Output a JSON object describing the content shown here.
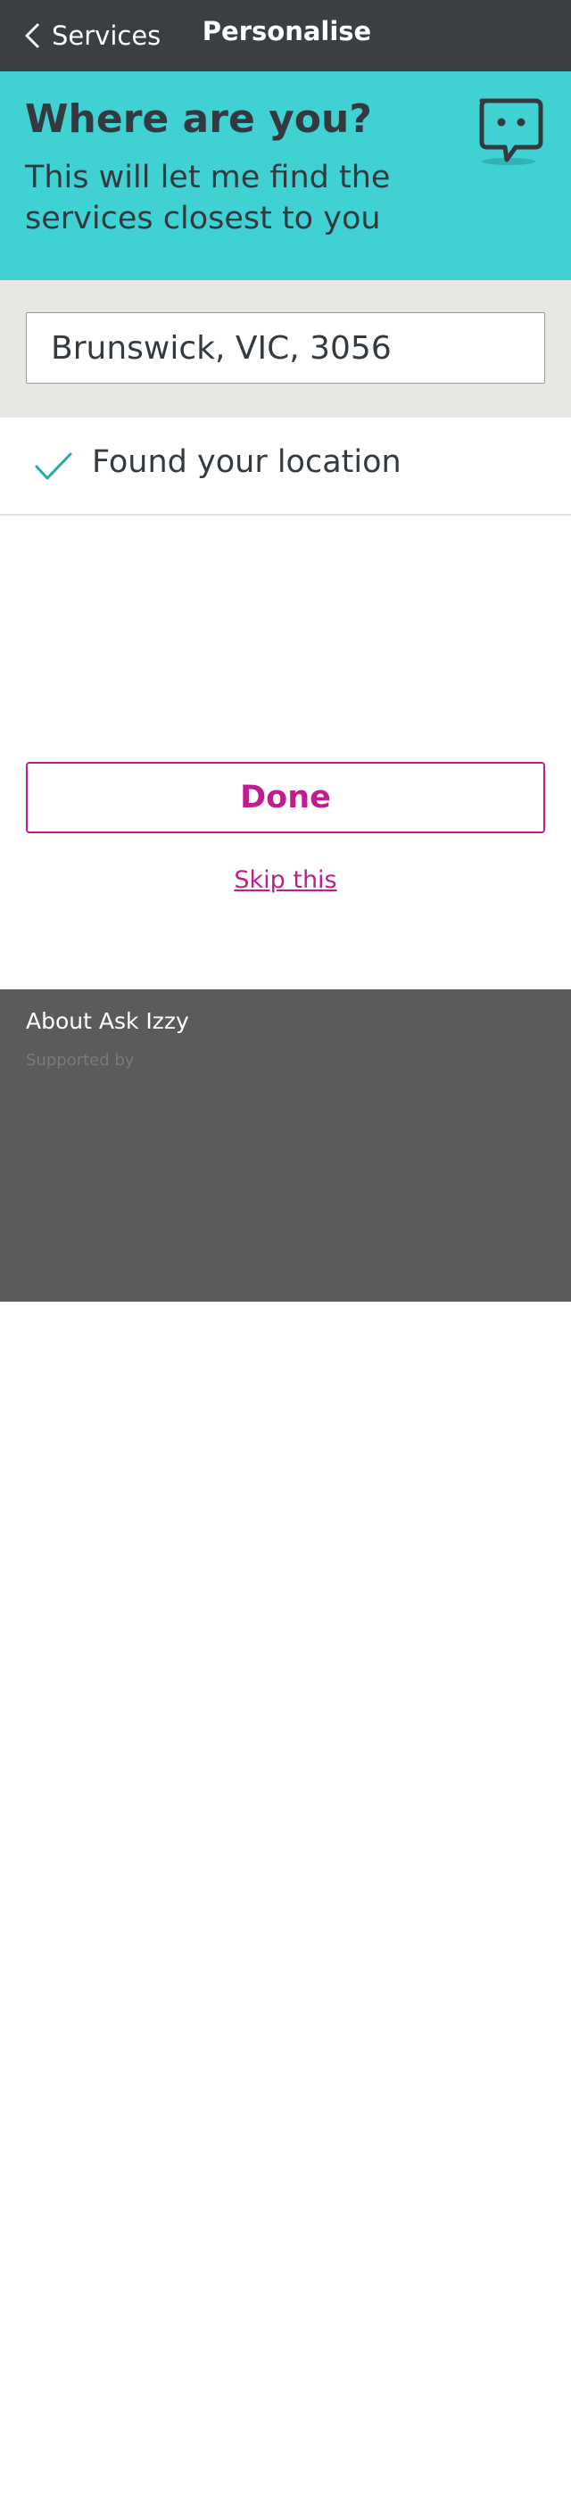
{
  "header": {
    "back_label": "Services",
    "title": "Personalise"
  },
  "hero": {
    "heading": "Where are you?",
    "subtext": "This will let me find the services closest to you",
    "icon": "chat-bubble-face-icon"
  },
  "location": {
    "value": "Brunswick, VIC, 3056",
    "status_text": "Found your location"
  },
  "actions": {
    "done_label": "Done",
    "skip_label": "Skip this"
  },
  "footer": {
    "about_label": "About Ask Izzy",
    "supported_by_label": "Supported by"
  },
  "colors": {
    "appbar": "#3a3f44",
    "hero": "#40d2d3",
    "accent": "#c21d8f",
    "check": "#2aa7a7",
    "footer": "#5b5b5b"
  }
}
